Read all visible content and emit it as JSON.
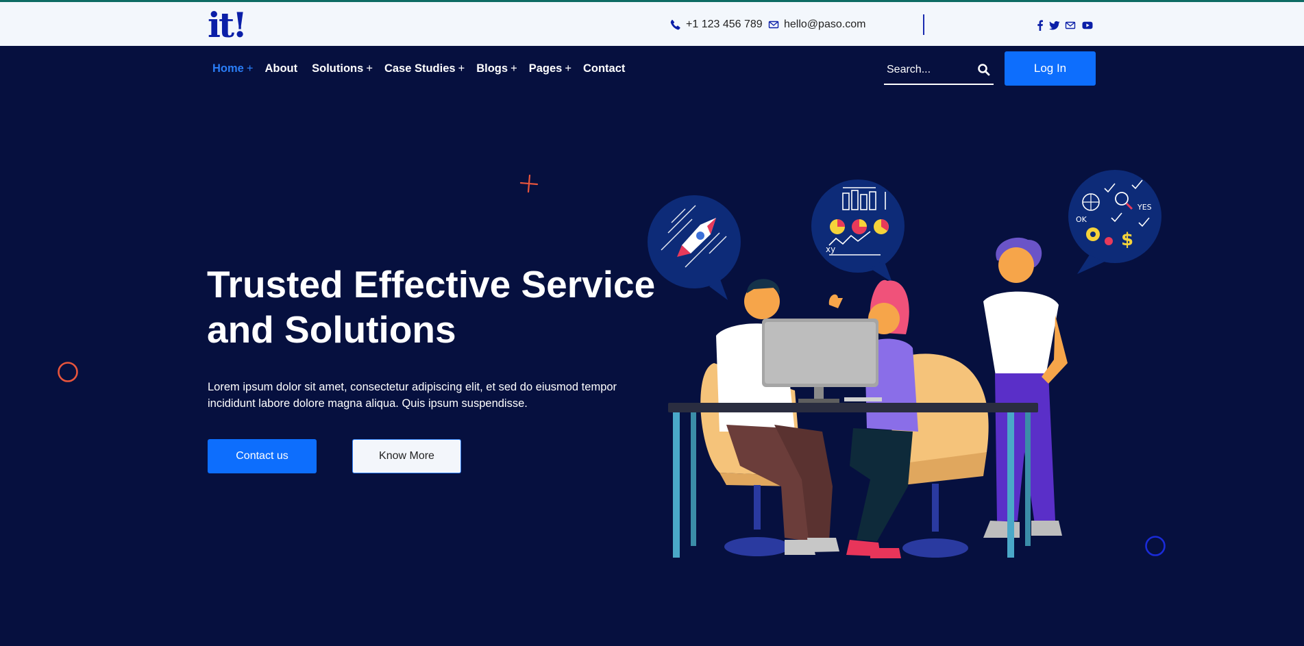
{
  "topbar": {
    "logo": "it!",
    "phone": "+1 123 456 789",
    "email": "hello@paso.com",
    "social_icons": [
      "facebook-icon",
      "twitter-icon",
      "envelope-icon",
      "youtube-icon"
    ]
  },
  "nav": {
    "items": [
      {
        "label": "Home",
        "suffix": "+"
      },
      {
        "label": "About",
        "suffix": ""
      },
      {
        "label": "Solutions",
        "suffix": "+"
      },
      {
        "label": "Case Studies",
        "suffix": "+"
      },
      {
        "label": "Blogs",
        "suffix": "+"
      },
      {
        "label": "Pages",
        "suffix": "+"
      },
      {
        "label": "Contact",
        "suffix": ""
      }
    ],
    "search_placeholder": "Search...",
    "login_label": "Log In"
  },
  "hero": {
    "title_line1": "Trusted Effective Service",
    "title_line2": "and Solutions",
    "description_line1": "Lorem ipsum dolor sit amet, consectetur adipiscing elit, et sed do eiusmod tempor",
    "description_line2": "incididunt labore dolore magna aliqua. Quis ipsum suspendisse.",
    "primary_button": "Contact us",
    "secondary_button": "Know More"
  },
  "illustration": {
    "bubble_ok": "OK",
    "bubble_yes": "YES",
    "bubble_xy": "xy"
  },
  "colors": {
    "background": "#06103f",
    "accent": "#0d6efd",
    "topbar": "#f3f7fc",
    "logo": "#0b1fa8"
  }
}
